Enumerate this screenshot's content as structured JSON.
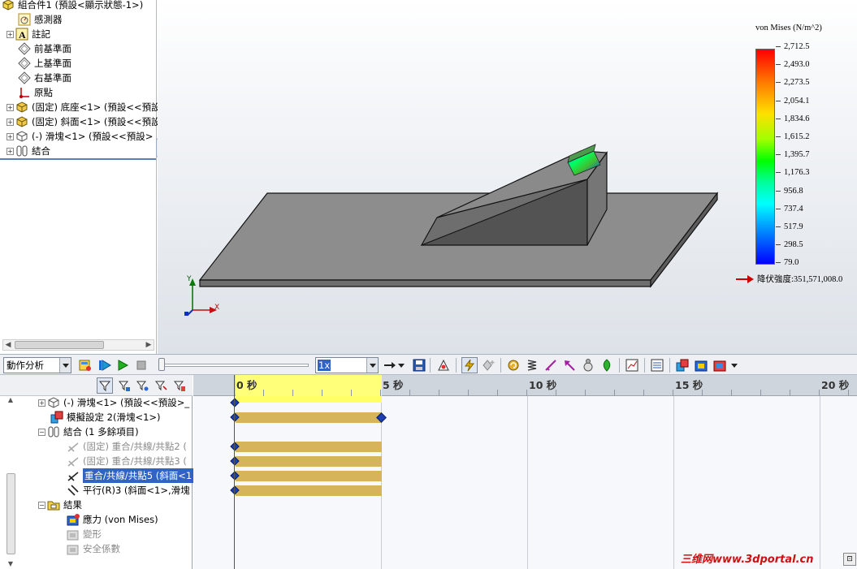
{
  "feature_tree": {
    "items": [
      {
        "label": "組合件1 (預設<顯示狀態-1>)",
        "icon": "assembly-icon"
      },
      {
        "label": "感測器",
        "icon": "sensor-icon"
      },
      {
        "label": "註記",
        "icon": "annotation-icon"
      },
      {
        "label": "前基準面",
        "icon": "plane-icon"
      },
      {
        "label": "上基準面",
        "icon": "plane-icon"
      },
      {
        "label": "右基準面",
        "icon": "plane-icon"
      },
      {
        "label": "原點",
        "icon": "origin-icon"
      },
      {
        "label": "(固定) 底座<1> (預設<<預設",
        "icon": "part-icon"
      },
      {
        "label": "(固定) 斜面<1> (預設<<預設",
        "icon": "part-icon"
      },
      {
        "label": "(-) 滑塊<1> (預設<<預設>",
        "icon": "part-icon"
      },
      {
        "label": "結合",
        "icon": "mates-icon"
      }
    ]
  },
  "viewport": {
    "legend": {
      "title": "von Mises (N/m^2)",
      "values": [
        "2,712.5",
        "2,493.0",
        "2,273.5",
        "2,054.1",
        "1,834.6",
        "1,615.2",
        "1,395.7",
        "1,176.3",
        "956.8",
        "737.4",
        "517.9",
        "298.5",
        "79.0"
      ],
      "yield_label": "降伏強度:351,571,008.0"
    },
    "axes": {
      "y": "Y",
      "x": "X"
    }
  },
  "toolbar": {
    "study_type": "動作分析",
    "playback_speed": "1x"
  },
  "motion_tree": {
    "items": [
      {
        "label": "(-) 滑塊<1> (預設<<預設>_",
        "style": "normal"
      },
      {
        "label": "模擬設定 2(滑塊<1>)",
        "style": "normal"
      },
      {
        "label": "結合 (1 多餘項目)",
        "style": "normal"
      },
      {
        "label": "(固定) 重合/共線/共點2 (",
        "style": "dim"
      },
      {
        "label": "(固定) 重合/共線/共點3 (",
        "style": "dim"
      },
      {
        "label": "重合/共線/共點5 (斜面<1",
        "style": "sel"
      },
      {
        "label": "平行(R)3 (斜面<1>,滑塊",
        "style": "normal"
      },
      {
        "label": "結果",
        "style": "normal"
      },
      {
        "label": "應力 (von Mises)",
        "style": "normal"
      },
      {
        "label": "變形",
        "style": "dim"
      },
      {
        "label": "安全係數",
        "style": "dim"
      }
    ]
  },
  "timeline": {
    "ticks": [
      "0 秒",
      "5 秒",
      "10 秒",
      "15 秒",
      "20 秒"
    ]
  },
  "watermark": "三维网www.3dportal.cn"
}
